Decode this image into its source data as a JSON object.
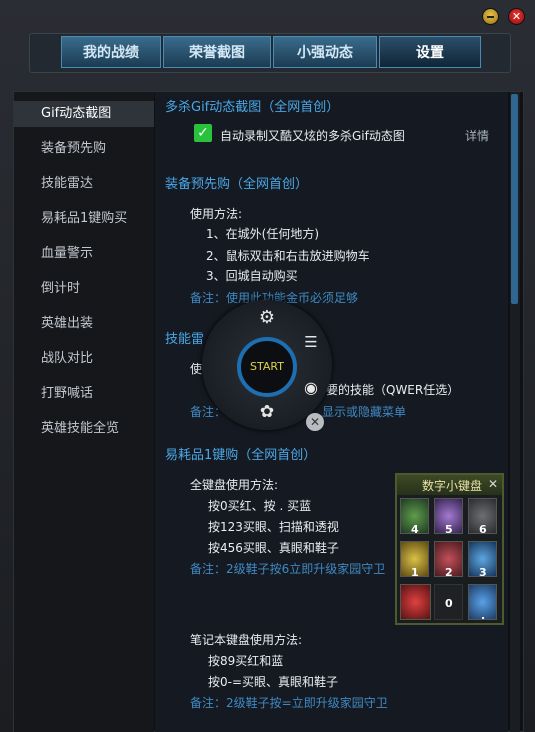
{
  "window": {
    "minimize_label": "",
    "close_label": "✕"
  },
  "tabs": [
    {
      "label": "我的战绩"
    },
    {
      "label": "荣誉截图"
    },
    {
      "label": "小强动态"
    },
    {
      "label": "设置"
    }
  ],
  "sidebar": {
    "items": [
      {
        "label": "Gif动态截图"
      },
      {
        "label": "装备预先购"
      },
      {
        "label": "技能雷达"
      },
      {
        "label": "易耗品1键购买"
      },
      {
        "label": "血量警示"
      },
      {
        "label": "倒计时"
      },
      {
        "label": "英雄出装"
      },
      {
        "label": "战队对比"
      },
      {
        "label": "打野喊话"
      },
      {
        "label": "英雄技能全览"
      }
    ]
  },
  "gif": {
    "title": "多杀Gif动态截图（全网首创）",
    "checkbox_label": "自动录制又酷又炫的多杀Gif动态图",
    "details_link": "详情"
  },
  "prebuy": {
    "title": "装备预先购（全网首创）",
    "usage": "使用方法:",
    "steps": [
      "1、在城外(任何地方)",
      "2、鼠标双击和右击放进购物车",
      "3、回城自动购买"
    ],
    "note": "备注：使用此功能金币必须足够"
  },
  "radar": {
    "title_visible": "技能雷",
    "usage_partial": "使",
    "line_partial": "要的技能（QWER任选）",
    "note_partial": "备注：",
    "note_tail": "显示或隐藏菜单"
  },
  "consumable": {
    "title": "易耗品1键购（全网首创）",
    "full_kb_title": "全键盘使用方法:",
    "full_kb_lines": [
      "按0买红、按 . 买蓝",
      "按123买眼、扫描和透视",
      "按456买眼、真眼和鞋子"
    ],
    "full_kb_note": "备注：2级鞋子按6立即升级家园守卫",
    "notebook_title": "笔记本键盘使用方法:",
    "notebook_lines": [
      "按89买红和蓝",
      "按0-=买眼、真眼和鞋子"
    ],
    "notebook_note": "备注：2级鞋子按=立即升级家园守卫"
  },
  "overlay": {
    "start_label": "START",
    "icons": [
      "gear-icon",
      "list-search-icon",
      "eye-icon",
      "flower-icon"
    ],
    "close_label": "✕"
  },
  "numpad": {
    "title": "数字小键盘",
    "close_label": "✕",
    "keys": [
      "4",
      "5",
      "6",
      "1",
      "2",
      "3",
      "0",
      "."
    ]
  },
  "colors": {
    "accent": "#4aa7e6",
    "note": "#3f89c2",
    "check": "#29c23c"
  }
}
